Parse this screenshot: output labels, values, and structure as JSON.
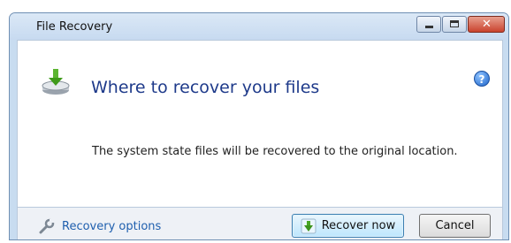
{
  "window": {
    "title": "File Recovery"
  },
  "main": {
    "heading": "Where to recover your files",
    "message": "The system state files will be recovered to the original location."
  },
  "footer": {
    "options_link": "Recovery options",
    "recover_button": "Recover now",
    "cancel_button": "Cancel"
  },
  "icons": {
    "header": "download-drive-icon",
    "help": "help-icon",
    "options": "wrench-icon",
    "recover": "green-down-arrow-icon"
  },
  "colors": {
    "heading": "#1e3a8a",
    "link": "#1f5fae",
    "close_button": "#c9432e"
  }
}
